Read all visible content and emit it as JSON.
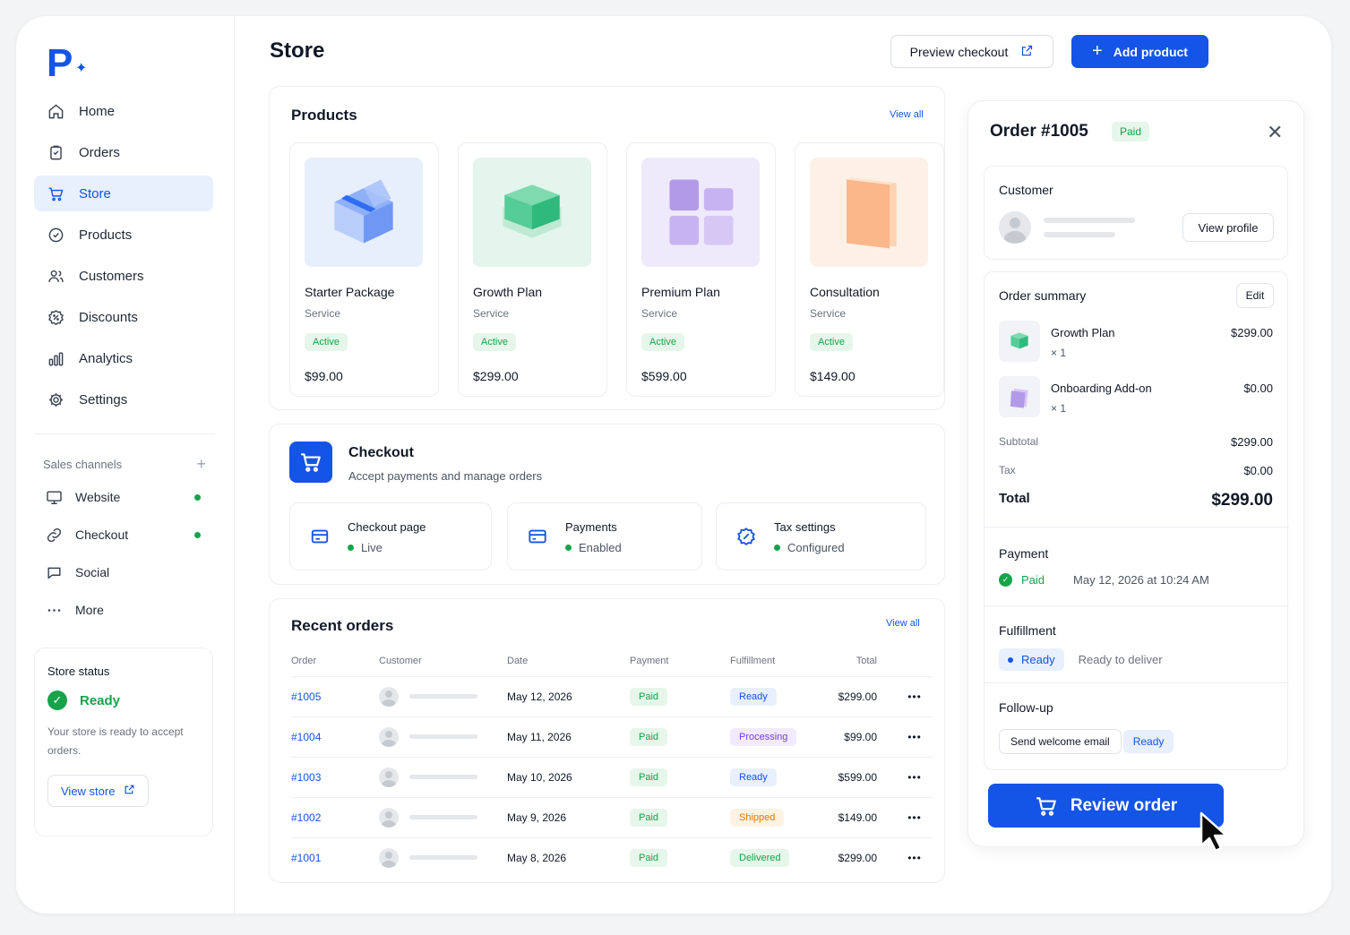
{
  "brand": {
    "logo_letter": "P",
    "spark": "✦"
  },
  "sidebar": {
    "items": [
      {
        "label": "Home",
        "icon": "home-icon",
        "active": false
      },
      {
        "label": "Orders",
        "icon": "clipboard-icon",
        "active": false
      },
      {
        "label": "Store",
        "icon": "cart-icon",
        "active": true
      },
      {
        "label": "Products",
        "icon": "tag-icon",
        "active": false
      },
      {
        "label": "Customers",
        "icon": "users-icon",
        "active": false
      },
      {
        "label": "Discounts",
        "icon": "discount-icon",
        "active": false
      },
      {
        "label": "Analytics",
        "icon": "bar-chart-icon",
        "active": false
      },
      {
        "label": "Settings",
        "icon": "gear-icon",
        "active": false
      }
    ],
    "channels_label": "Sales channels",
    "channels_add": "+",
    "channels": [
      {
        "label": "Website",
        "icon": "monitor-icon",
        "online": true
      },
      {
        "label": "Checkout",
        "icon": "link-icon",
        "online": true
      },
      {
        "label": "Social",
        "icon": "chat-icon",
        "online": false
      },
      {
        "label": "More",
        "icon": "more-icon",
        "online": false
      }
    ],
    "store_status": {
      "title": "Store status",
      "state": "Ready",
      "description": "Your store is ready to accept orders.",
      "button": "View store"
    }
  },
  "header": {
    "title": "Store",
    "preview_button": "Preview checkout",
    "add_button": "Add product"
  },
  "products": {
    "title": "Products",
    "view_all": "View all",
    "items": [
      {
        "name": "Starter Package",
        "type": "Service",
        "status": "Active",
        "price": "$99.00",
        "icon": "cube-icon"
      },
      {
        "name": "Growth Plan",
        "type": "Service",
        "status": "Active",
        "price": "$299.00",
        "icon": "stack-icon"
      },
      {
        "name": "Premium Plan",
        "type": "Service",
        "status": "Active",
        "price": "$599.00",
        "icon": "grid-icon"
      },
      {
        "name": "Consultation",
        "type": "Service",
        "status": "Active",
        "price": "$149.00",
        "icon": "folder-icon"
      }
    ]
  },
  "checkout": {
    "title": "Checkout",
    "subtitle": "Accept payments and manage orders",
    "boxes": [
      {
        "label": "Checkout page",
        "status": "Live",
        "icon": "card-icon"
      },
      {
        "label": "Payments",
        "status": "Enabled",
        "icon": "credit-card-icon"
      },
      {
        "label": "Tax settings",
        "status": "Configured",
        "icon": "badge-percent-icon"
      }
    ]
  },
  "orders": {
    "title": "Recent orders",
    "view_all": "View all",
    "columns": [
      "Order",
      "Customer",
      "Date",
      "Payment",
      "Fulfillment",
      "Total"
    ],
    "rows": [
      {
        "order": "#1005",
        "date": "May 12, 2026",
        "payment": "Paid",
        "fulfillment": "Ready",
        "total": "$299.00"
      },
      {
        "order": "#1004",
        "date": "May 11, 2026",
        "payment": "Paid",
        "fulfillment": "Processing",
        "total": "$99.00"
      },
      {
        "order": "#1003",
        "date": "May 10, 2026",
        "payment": "Paid",
        "fulfillment": "Ready",
        "total": "$599.00"
      },
      {
        "order": "#1002",
        "date": "May 9, 2026",
        "payment": "Paid",
        "fulfillment": "Shipped",
        "total": "$149.00"
      },
      {
        "order": "#1001",
        "date": "May 8, 2026",
        "payment": "Paid",
        "fulfillment": "Delivered",
        "total": "$299.00"
      }
    ],
    "more_glyph": "•••"
  },
  "order_panel": {
    "title": "Order #1005",
    "badge": "Paid",
    "close_glyph": "✕",
    "customer": {
      "title": "Customer",
      "button": "View profile"
    },
    "summary": {
      "title": "Order summary",
      "edit": "Edit",
      "items": [
        {
          "name": "Growth Plan",
          "qty": "× 1",
          "price": "$299.00"
        },
        {
          "name": "Onboarding Add-on",
          "qty": "× 1",
          "price": "$0.00"
        }
      ],
      "subtotal_label": "Subtotal",
      "subtotal": "$299.00",
      "tax_label": "Tax",
      "tax": "$0.00",
      "total_label": "Total",
      "total": "$299.00"
    },
    "payment": {
      "title": "Payment",
      "status": "Paid",
      "date": "May 12, 2026 at 10:24 AM"
    },
    "fulfillment": {
      "title": "Fulfillment",
      "status": "Ready",
      "note": "Ready to deliver"
    },
    "followup": {
      "title": "Follow-up",
      "action": "Send welcome email",
      "status": "Ready"
    },
    "review_button": "Review order"
  },
  "colors": {
    "accent": "#1454e6",
    "success": "#16a34a",
    "warning": "#d97706",
    "purple": "#7c3aed"
  }
}
